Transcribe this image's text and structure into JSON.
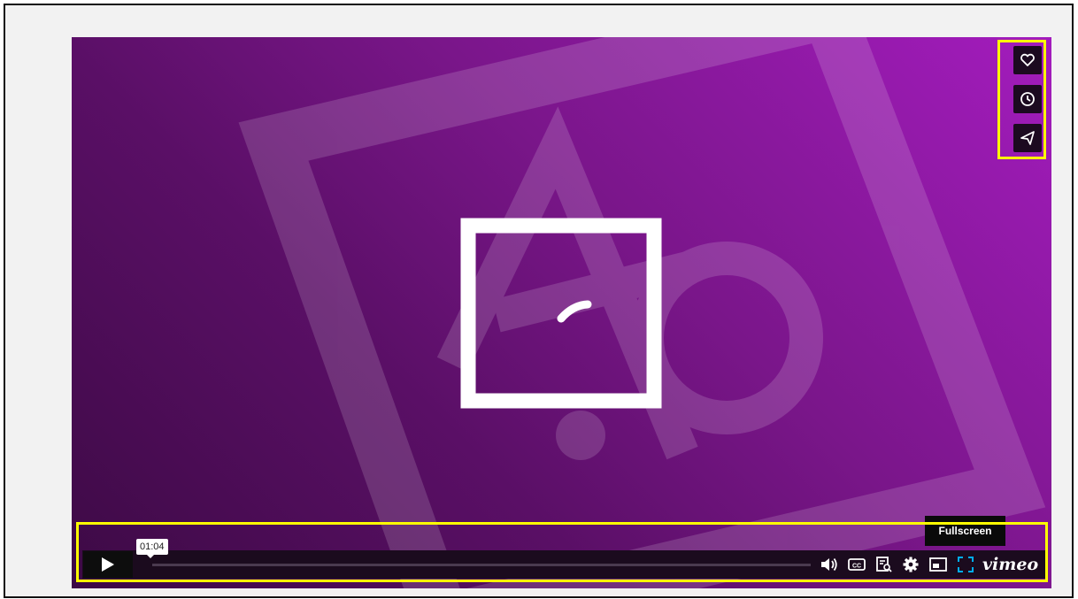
{
  "player": {
    "timecode": "01:04",
    "progress_fraction": 0.0,
    "tooltip": "Fullscreen",
    "brand": "vimeo",
    "accent_color": "#00adef",
    "side_buttons": [
      "heart-icon",
      "clock-icon",
      "send-icon"
    ],
    "controls": [
      "play-icon",
      "volume-icon",
      "captions-icon",
      "transcript-icon",
      "settings-icon",
      "pip-icon",
      "fullscreen-icon"
    ]
  },
  "highlight_color": "#ffff00"
}
